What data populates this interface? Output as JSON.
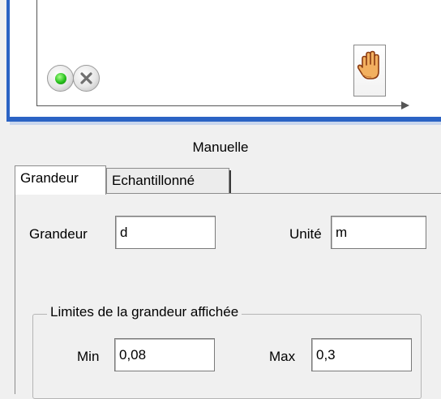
{
  "graph": {
    "controls": {
      "start": {
        "icon": "green-dot-icon"
      },
      "cancel": {
        "icon": "cancel-x-icon"
      },
      "manual": {
        "icon": "hand-icon"
      }
    }
  },
  "mode_label": "Manuelle",
  "tabs": [
    {
      "label": "Grandeur",
      "active": true
    },
    {
      "label": "Echantillonné",
      "active": false
    }
  ],
  "form": {
    "grandeur_label": "Grandeur",
    "grandeur_value": "d",
    "unite_label": "Unité",
    "unite_value": "m",
    "limits": {
      "title": "Limites de la grandeur affichée",
      "min_label": "Min",
      "min_value": "0,08",
      "max_label": "Max",
      "max_value": "0,3"
    }
  },
  "colors": {
    "panel_border": "#2b63c4",
    "indicator_green": "#27c01c"
  }
}
